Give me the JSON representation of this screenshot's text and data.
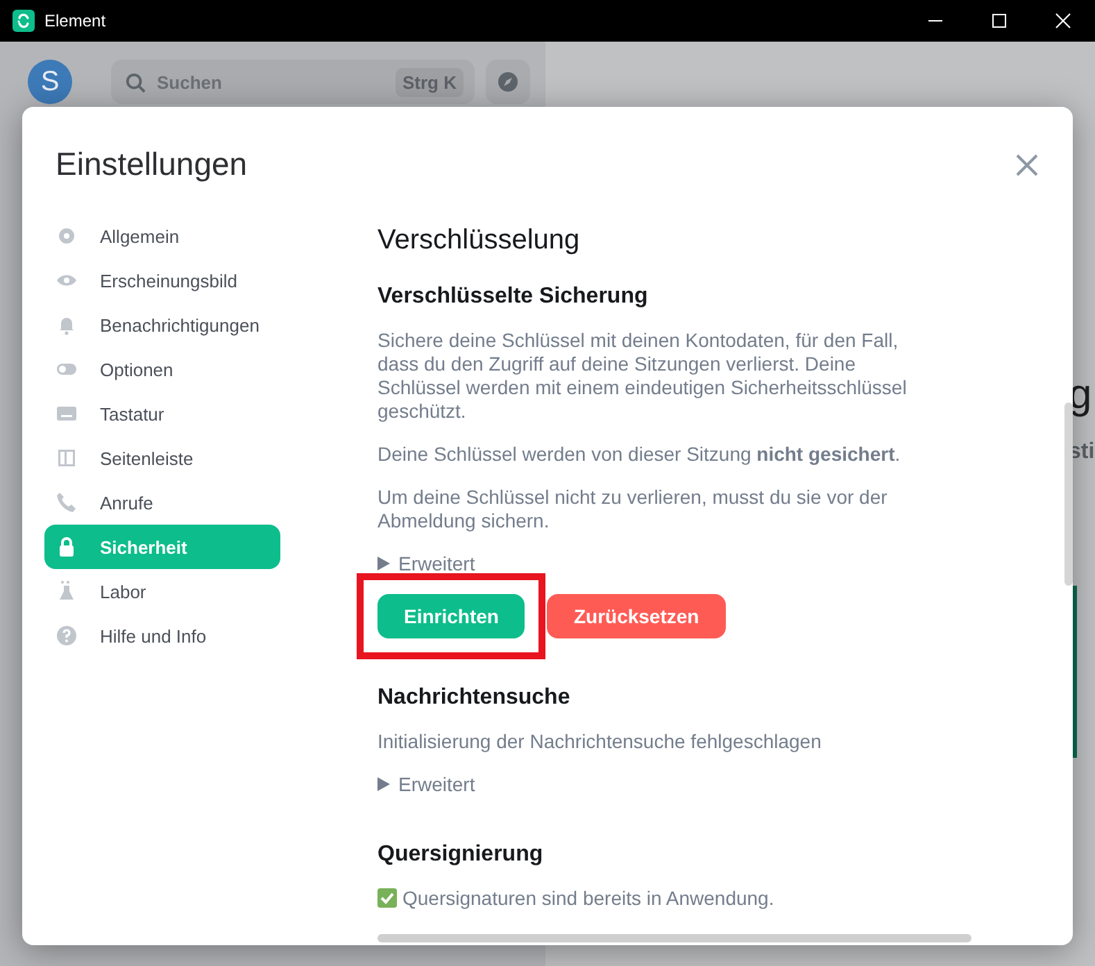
{
  "window": {
    "title": "Element"
  },
  "background": {
    "avatar": "S",
    "search": {
      "placeholder": "Suchen",
      "shortcut": "Strg K"
    },
    "cut_texts": [
      "g",
      "sti"
    ]
  },
  "dialog": {
    "title": "Einstellungen",
    "sidebar": [
      {
        "label": "Allgemein",
        "selected": false
      },
      {
        "label": "Erscheinungsbild",
        "selected": false
      },
      {
        "label": "Benachrichtigungen",
        "selected": false
      },
      {
        "label": "Optionen",
        "selected": false
      },
      {
        "label": "Tastatur",
        "selected": false
      },
      {
        "label": "Seitenleiste",
        "selected": false
      },
      {
        "label": "Anrufe",
        "selected": false
      },
      {
        "label": "Sicherheit",
        "selected": true
      },
      {
        "label": "Labor",
        "selected": false
      },
      {
        "label": "Hilfe und Info",
        "selected": false
      }
    ],
    "content": {
      "title": "Verschlüsselung",
      "sections": [
        {
          "heading": "Verschlüsselte Sicherung",
          "paragraphs": [
            "Sichere deine Schlüssel mit deinen Kontodaten, für den Fall, dass du den Zugriff auf deine Sitzungen verlierst. Deine Schlüssel werden mit einem eindeutigen Sicherheitsschlüssel geschützt.",
            "Deine Schlüssel werden von dieser Sitzung **nicht gesichert**.",
            "Um deine Schlüssel nicht zu verlieren, musst du sie vor der Abmeldung sichern."
          ],
          "disclosure": {
            "label": "Erweitert",
            "expanded": false
          },
          "buttons": [
            {
              "label": "Einrichten",
              "kind": "primary",
              "highlighted": true
            },
            {
              "label": "Zurücksetzen",
              "kind": "danger",
              "highlighted": false
            }
          ]
        },
        {
          "heading": "Nachrichtensuche",
          "paragraphs": [
            "Initialisierung der Nachrichtensuche fehlgeschlagen"
          ],
          "disclosure": {
            "label": "Erweitert",
            "expanded": false
          }
        },
        {
          "heading": "Quersignierung",
          "status": {
            "checked": true,
            "text": "Quersignaturen sind bereits in Anwendung."
          }
        }
      ]
    }
  }
}
